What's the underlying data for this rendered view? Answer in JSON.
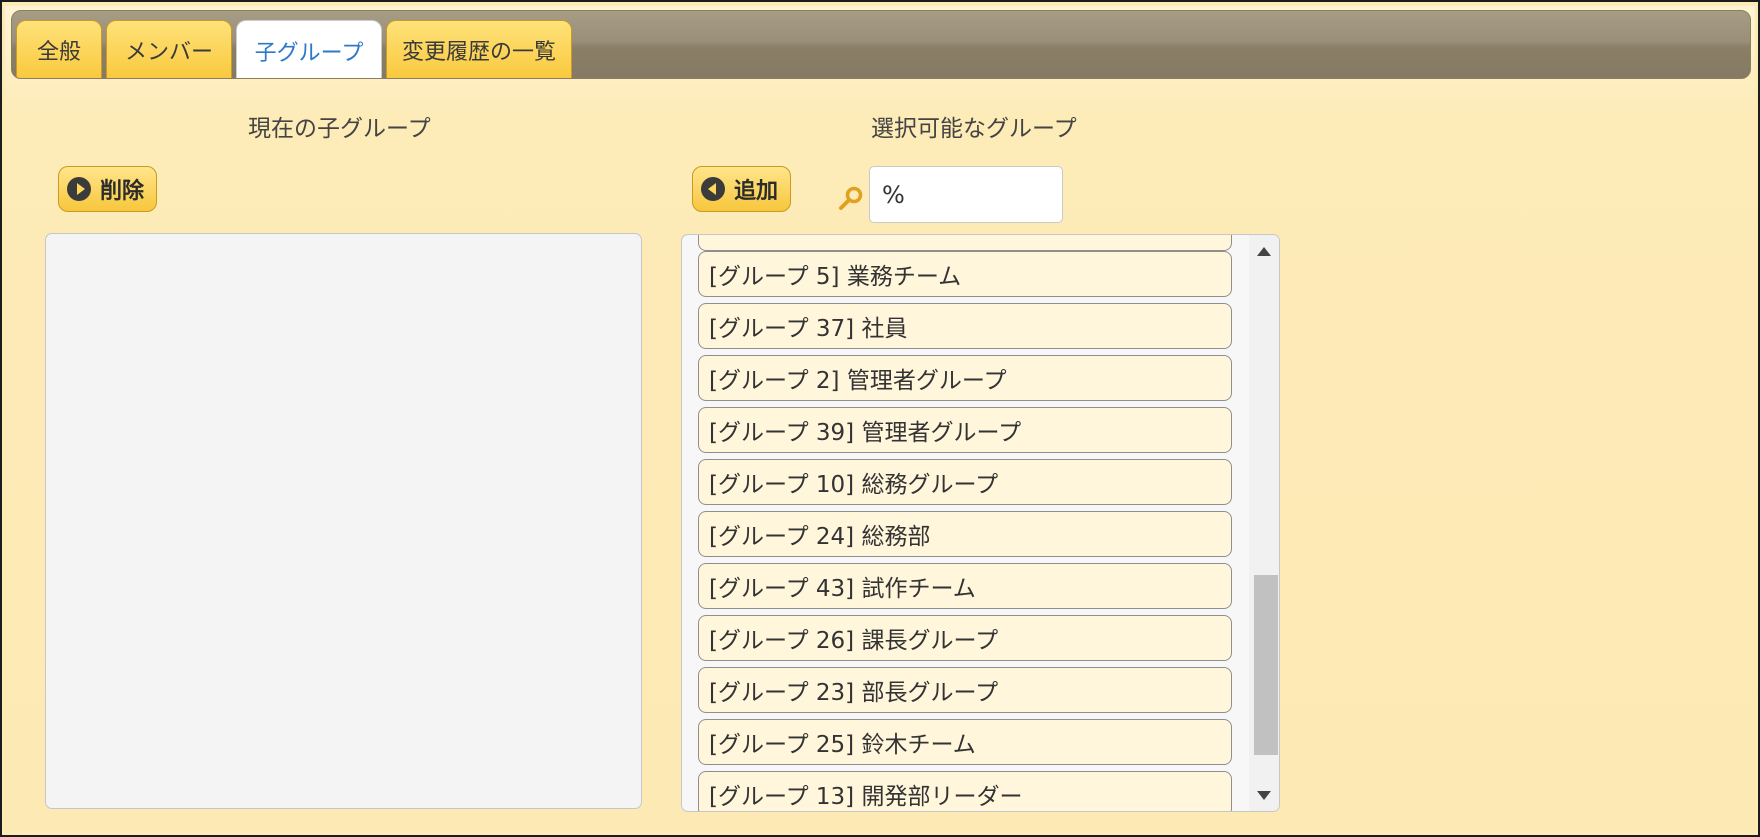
{
  "tabs": [
    {
      "label": "全般"
    },
    {
      "label": "メンバー"
    },
    {
      "label": "子グループ"
    },
    {
      "label": "変更履歴の一覧"
    }
  ],
  "left_panel": {
    "title": "現在の子グループ",
    "remove_button": "削除"
  },
  "right_panel": {
    "title": "選択可能なグループ",
    "add_button": "追加",
    "search": {
      "value": "%"
    },
    "groups": [
      "[グループ 5] 業務チーム",
      "[グループ 37] 社員",
      "[グループ 2] 管理者グループ",
      "[グループ 39] 管理者グループ",
      "[グループ 10] 総務グループ",
      "[グループ 24] 総務部",
      "[グループ 43] 試作チーム",
      "[グループ 26] 課長グループ",
      "[グループ 23] 部長グループ",
      "[グループ 25] 鈴木チーム",
      "[グループ 13] 開発部リーダー"
    ]
  },
  "colors": {
    "accent": "#f9c93d",
    "active_tab_text": "#2d78c8",
    "background": "#fdeab6"
  },
  "icons": [
    "play-right-icon",
    "play-left-icon",
    "search-icon"
  ]
}
